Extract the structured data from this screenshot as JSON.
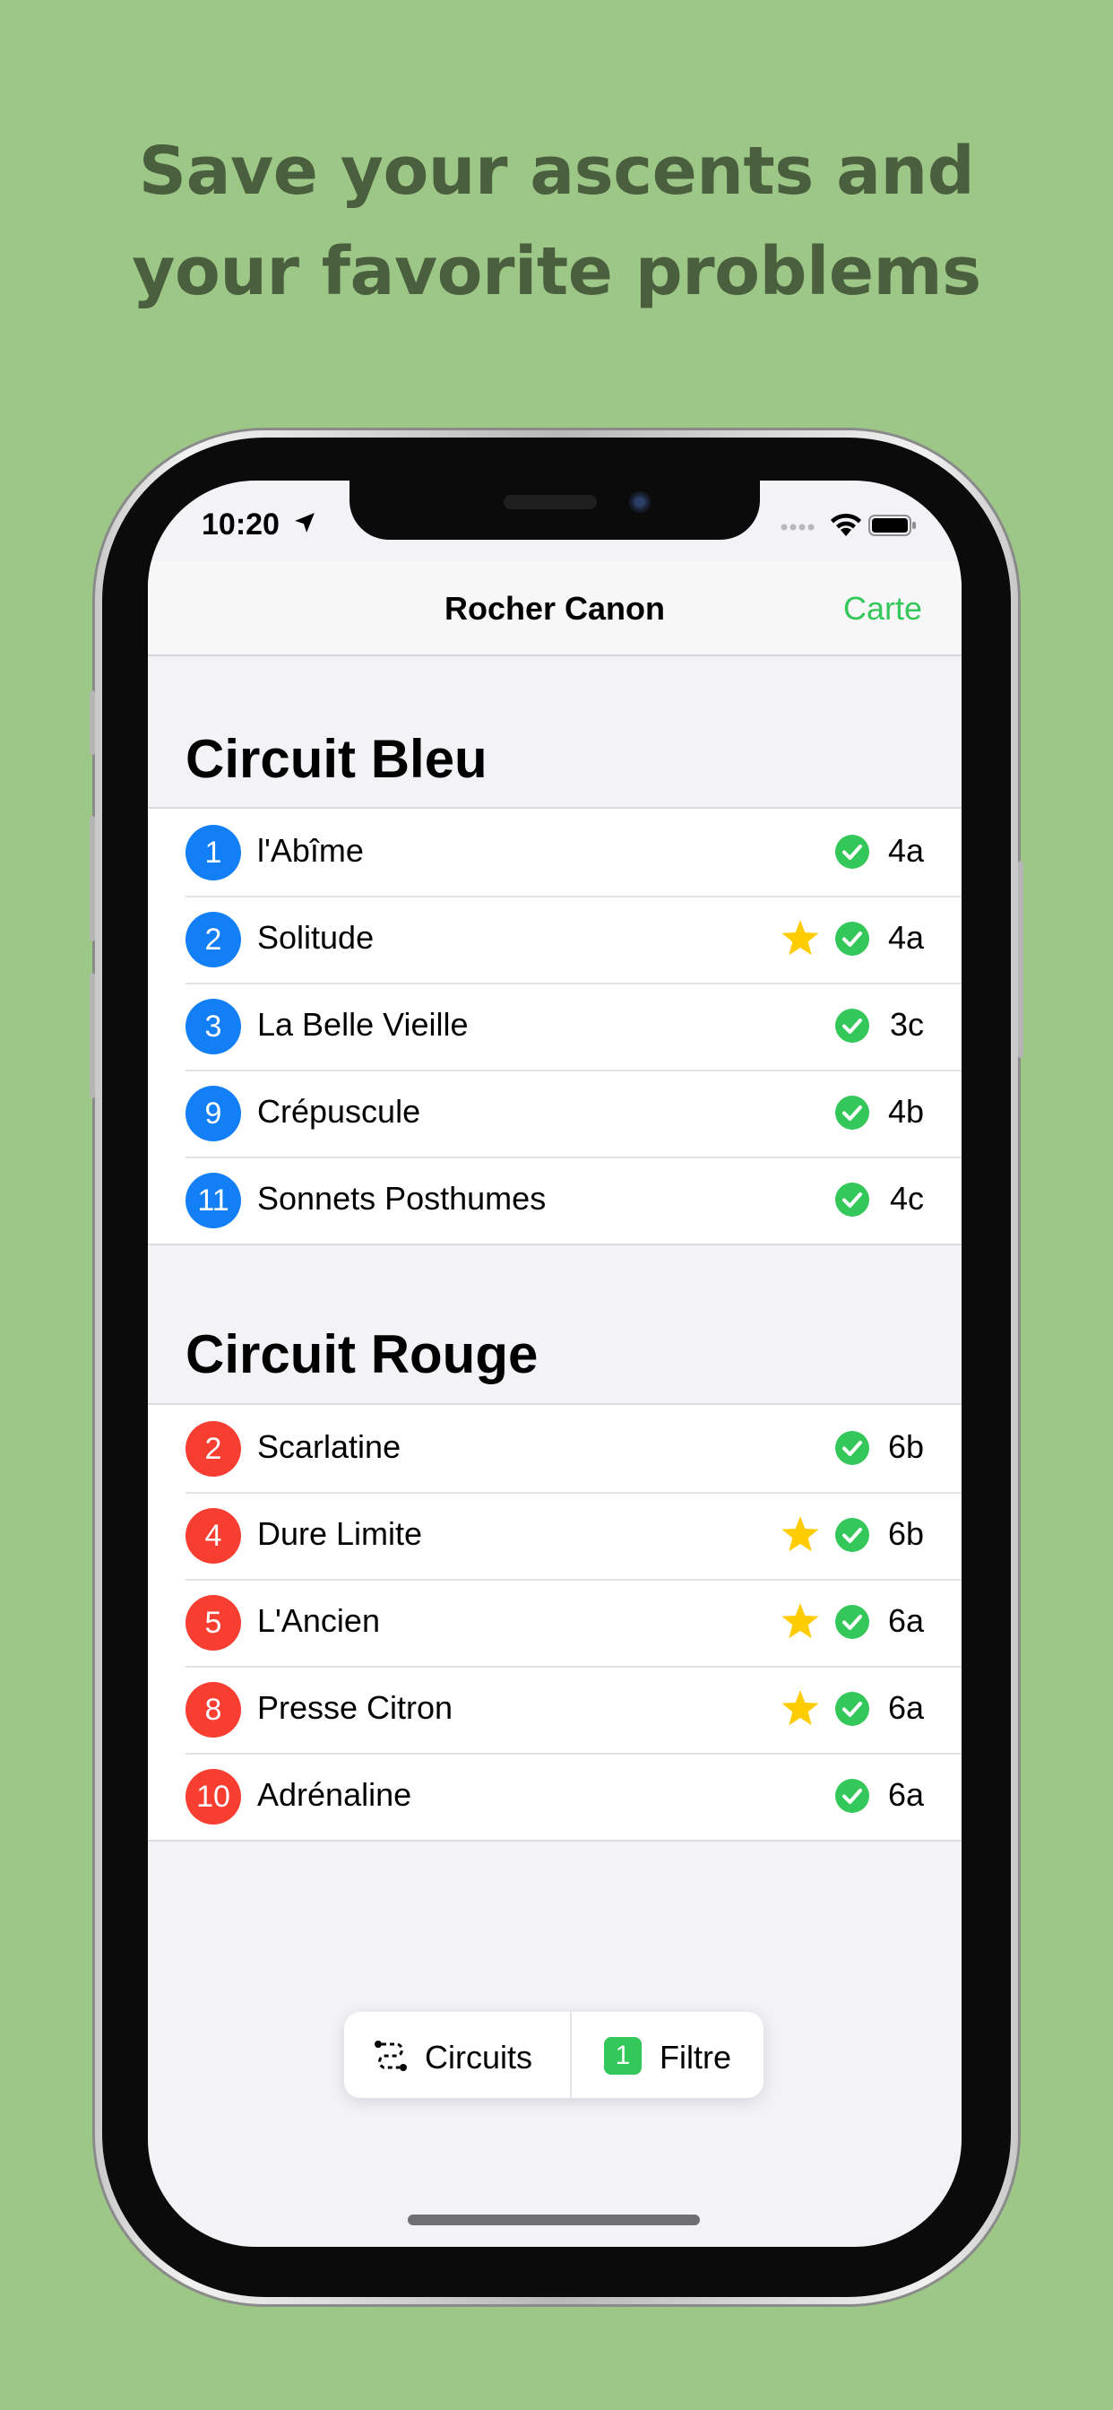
{
  "headline": {
    "line1": "Save your ascents and",
    "line2": "your favorite problems"
  },
  "status_bar": {
    "time": "10:20",
    "location_icon": "location-arrow-icon",
    "signal_icon": "cellular-dots-icon",
    "wifi_icon": "wifi-icon",
    "battery_icon": "battery-icon"
  },
  "nav": {
    "title": "Rocher Canon",
    "action_label": "Carte"
  },
  "colors": {
    "accent_green": "#34c759",
    "circuit_blue": "#137ff6",
    "circuit_red": "#f83d31",
    "star_yellow": "#ffcc00",
    "background": "#9dc787"
  },
  "sections": [
    {
      "title": "Circuit Bleu",
      "color": "blue",
      "problems": [
        {
          "number": "1",
          "name": "l'Abîme",
          "favorite": false,
          "done": true,
          "grade": "4a"
        },
        {
          "number": "2",
          "name": "Solitude",
          "favorite": true,
          "done": true,
          "grade": "4a"
        },
        {
          "number": "3",
          "name": "La Belle Vieille",
          "favorite": false,
          "done": true,
          "grade": "3c"
        },
        {
          "number": "9",
          "name": "Crépuscule",
          "favorite": false,
          "done": true,
          "grade": "4b"
        },
        {
          "number": "11",
          "name": "Sonnets Posthumes",
          "favorite": false,
          "done": true,
          "grade": "4c"
        }
      ]
    },
    {
      "title": "Circuit Rouge",
      "color": "red",
      "problems": [
        {
          "number": "2",
          "name": "Scarlatine",
          "favorite": false,
          "done": true,
          "grade": "6b"
        },
        {
          "number": "4",
          "name": "Dure Limite",
          "favorite": true,
          "done": true,
          "grade": "6b"
        },
        {
          "number": "5",
          "name": "L'Ancien",
          "favorite": true,
          "done": true,
          "grade": "6a"
        },
        {
          "number": "8",
          "name": "Presse Citron",
          "favorite": true,
          "done": true,
          "grade": "6a"
        },
        {
          "number": "10",
          "name": "Adrénaline",
          "favorite": false,
          "done": true,
          "grade": "6a"
        }
      ]
    }
  ],
  "bottom_bar": {
    "circuits_label": "Circuits",
    "circuits_icon": "route-icon",
    "filter_count": "1",
    "filter_label": "Filtre"
  }
}
